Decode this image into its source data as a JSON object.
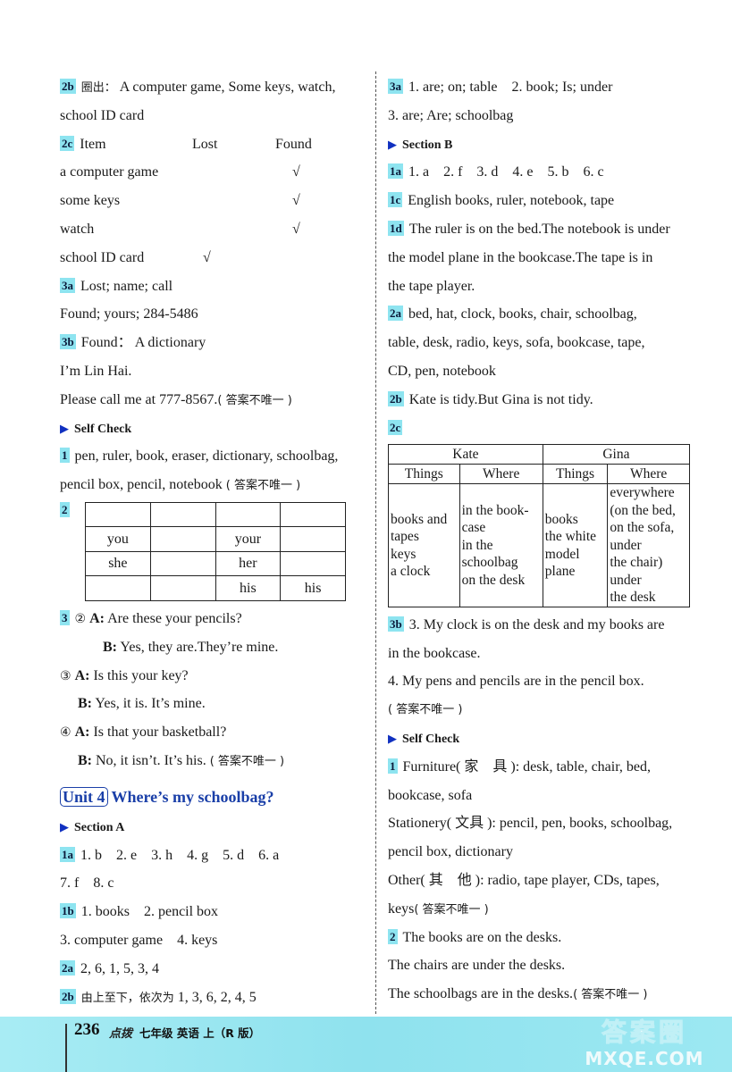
{
  "left_column": {
    "ex_2b": {
      "label": "2b",
      "prefix_cn": "圈出：",
      "line1": "A computer game, Some keys, watch,",
      "line2": "school ID card"
    },
    "ex_2c": {
      "label": "2c",
      "headers": [
        "Item",
        "Lost",
        "Found"
      ],
      "check_mark": "√",
      "rows": [
        {
          "item": "a computer game",
          "lost": false,
          "found": true
        },
        {
          "item": "some keys",
          "lost": false,
          "found": true
        },
        {
          "item": "watch",
          "lost": false,
          "found": true
        },
        {
          "item": "school ID card",
          "lost": true,
          "found": false
        }
      ]
    },
    "ex_3a": {
      "label": "3a",
      "line1": "Lost; name; call",
      "line2": "Found; yours; 284-5486"
    },
    "ex_3b": {
      "label": "3b",
      "line1": "Found：  A dictionary",
      "line2": "I’m Lin Hai.",
      "line3": "Please call me at 777-8567.",
      "note": "( 答案不唯一 )"
    },
    "self_check": {
      "title": "Self Check",
      "ex_1": {
        "label": "1",
        "line1": "pen, ruler, book, eraser, dictionary, schoolbag,",
        "line2": "pencil box, pencil, notebook",
        "note": "( 答案不唯一 )"
      },
      "ex_2": {
        "label": "2",
        "table": [
          [
            "",
            "",
            "",
            ""
          ],
          [
            "you",
            "",
            "your",
            ""
          ],
          [
            "she",
            "",
            "her",
            ""
          ],
          [
            "",
            "",
            "his",
            "his"
          ]
        ]
      },
      "ex_3": {
        "label": "3",
        "dialogs": [
          {
            "num": "②",
            "a": "Are these your pencils?",
            "b": "Yes, they are.They’re mine."
          },
          {
            "num": "③",
            "a": "Is this your key?",
            "b": "Yes, it is. It’s mine."
          },
          {
            "num": "④",
            "a": "Is that your basketball?",
            "b": "No, it isn’t. It’s his."
          }
        ],
        "speaker_a": "A:",
        "speaker_b": "B:",
        "note": "( 答案不唯一 )"
      }
    },
    "unit": {
      "box": "Unit 4",
      "title": "Where’s my schoolbag?"
    },
    "section_a": {
      "title": "Section A",
      "ex_1a": {
        "label": "1a",
        "line1": "1. b    2. e    3. h    4. g    5. d    6. a",
        "line2": "7. f    8. c"
      },
      "ex_1b": {
        "label": "1b",
        "line1": "1. books    2. pencil box",
        "line2": "3. computer game    4. keys"
      },
      "ex_2a": {
        "label": "2a",
        "text": "2, 6, 1, 5, 3, 4"
      },
      "ex_2b": {
        "label": "2b",
        "text_cn": "由上至下，依次为",
        "text": "1, 3, 6, 2, 4, 5"
      }
    }
  },
  "right_column": {
    "ex_3a": {
      "label": "3a",
      "line1": "1. are; on; table    2. book; Is; under",
      "line2": "3. are; Are; schoolbag"
    },
    "section_b": {
      "title": "Section B",
      "ex_1a": {
        "label": "1a",
        "text": "1. a    2. f    3. d    4. e    5. b    6. c"
      },
      "ex_1c": {
        "label": "1c",
        "text": "English books, ruler, notebook, tape"
      },
      "ex_1d": {
        "label": "1d",
        "line1": "The ruler is on the bed.The notebook is under",
        "line2": "the model plane in the bookcase.The tape is in",
        "line3": "the tape player."
      },
      "ex_2a": {
        "label": "2a",
        "line1": "bed, hat, clock, books, chair, schoolbag,",
        "line2": "table, desk, radio, keys, sofa, bookcase, tape,",
        "line3": "CD, pen, notebook"
      },
      "ex_2b": {
        "label": "2b",
        "text": "Kate is tidy.But Gina is not tidy."
      },
      "ex_2c": {
        "label": "2c",
        "groups": [
          "Kate",
          "Gina"
        ],
        "subheaders": [
          "Things",
          "Where",
          "Things",
          "Where"
        ],
        "cells": [
          [
            "books and",
            "tapes",
            "keys",
            "a clock"
          ],
          [
            "in the book-",
            "case",
            "in the",
            "schoolbag",
            "on the desk"
          ],
          [
            "books",
            "the white",
            "model",
            "plane"
          ],
          [
            "everywhere",
            "(on the bed,",
            "on the sofa,",
            "under",
            "the chair)",
            "under",
            "the desk"
          ]
        ]
      },
      "ex_3b": {
        "label": "3b",
        "line1": "3. My clock is on the desk and my books are",
        "line2": "in the bookcase.",
        "line3": "4. My pens and pencils are in the pencil box.",
        "note": "( 答案不唯一 )"
      }
    },
    "self_check": {
      "title": "Self Check",
      "ex_1": {
        "label": "1",
        "furniture": "Furniture( 家　具 ):  desk, table, chair, bed,",
        "furniture_cont": "bookcase, sofa",
        "stationery": "Stationery( 文具 ):  pencil, pen, books, schoolbag,",
        "stationery_cont": "pencil box, dictionary",
        "other": "Other( 其　他 ):  radio, tape player, CDs, tapes,",
        "other_cont": "keys",
        "note": "( 答案不唯一 )"
      },
      "ex_2": {
        "label": "2",
        "line1": "The books are on the desks.",
        "line2": "The chairs are under the desks.",
        "line3": "The schoolbags are in the desks.",
        "note": "( 答案不唯一 )"
      }
    }
  },
  "footer": {
    "page_number": "236",
    "brand": "点拨",
    "book_title": "七年级 英语 上（R 版）",
    "watermark_cn": "答案圈",
    "watermark_en": "MXQE.COM"
  },
  "colors": {
    "badge": "#8ee4f0",
    "section_arrow": "#1030c0",
    "unit_title": "#1a3fa8",
    "footer_band": "#9ce8f2"
  }
}
